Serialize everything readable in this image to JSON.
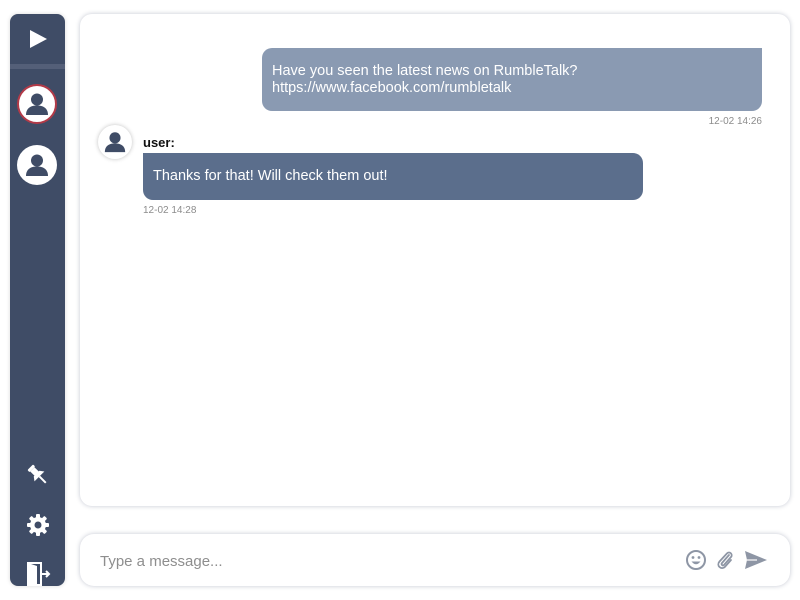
{
  "messages": [
    {
      "direction": "outgoing",
      "lines": [
        "Have you seen the latest news on RumbleTalk?",
        "https://www.facebook.com/rumbletalk"
      ],
      "time": "12-02 14:26",
      "bubble_color": "#8a9ab2"
    },
    {
      "direction": "incoming",
      "user": "user:",
      "text": "Thanks for that! Will check them out!",
      "time": "12-02 14:28",
      "bubble_color": "#5b6e8c"
    }
  ],
  "composer": {
    "placeholder": "Type a message...",
    "value": ""
  },
  "sidebar": {
    "background": "#3f4c66",
    "icons": [
      "play-icon",
      "user-avatar",
      "user-avatar",
      "pin-icon",
      "gear-icon",
      "exit-icon"
    ]
  },
  "colors": {
    "active_ring": "#b23a48"
  }
}
